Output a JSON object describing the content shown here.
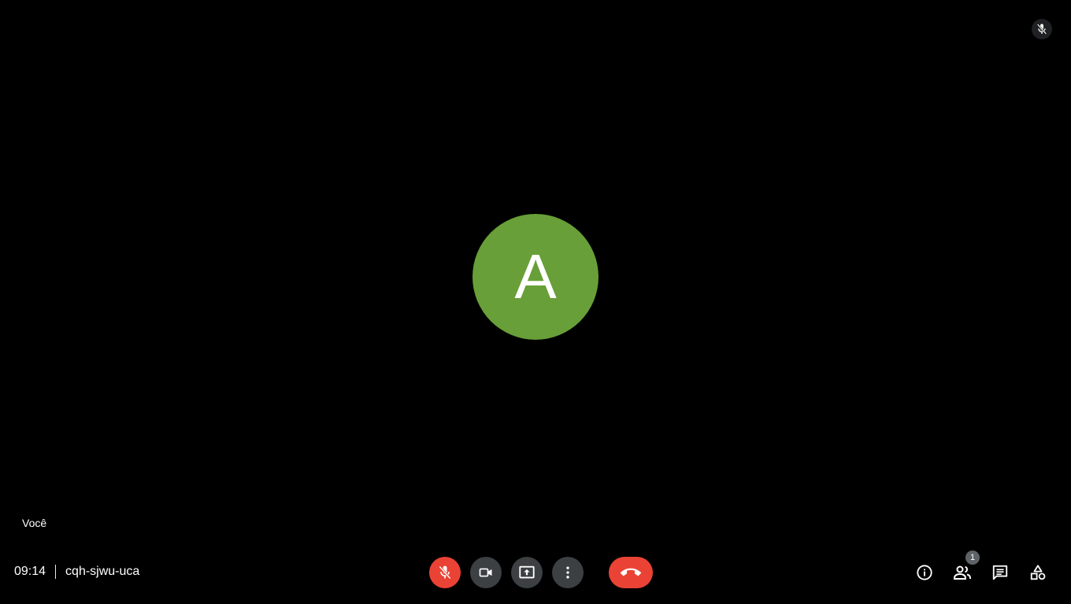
{
  "participant": {
    "avatar_initial": "A",
    "avatar_color": "#689f38",
    "self_label": "Você",
    "mic_status_icon": "mic-off-icon"
  },
  "meeting": {
    "time": "09:14",
    "code": "cqh-sjwu-uca"
  },
  "controls": {
    "mic": {
      "icon": "mic-off-icon",
      "state": "muted",
      "color": "#ea4335"
    },
    "camera": {
      "icon": "videocam-icon"
    },
    "present": {
      "icon": "present-screen-icon"
    },
    "more": {
      "icon": "more-vert-icon"
    },
    "hangup": {
      "icon": "call-end-icon",
      "color": "#ea4335"
    }
  },
  "tools": {
    "info": {
      "icon": "info-icon"
    },
    "people": {
      "icon": "people-icon",
      "count": "1"
    },
    "chat": {
      "icon": "chat-icon"
    },
    "activities": {
      "icon": "activities-icon"
    }
  },
  "colors": {
    "background": "#000000",
    "button_gray": "#3c4043",
    "danger_red": "#ea4335"
  }
}
